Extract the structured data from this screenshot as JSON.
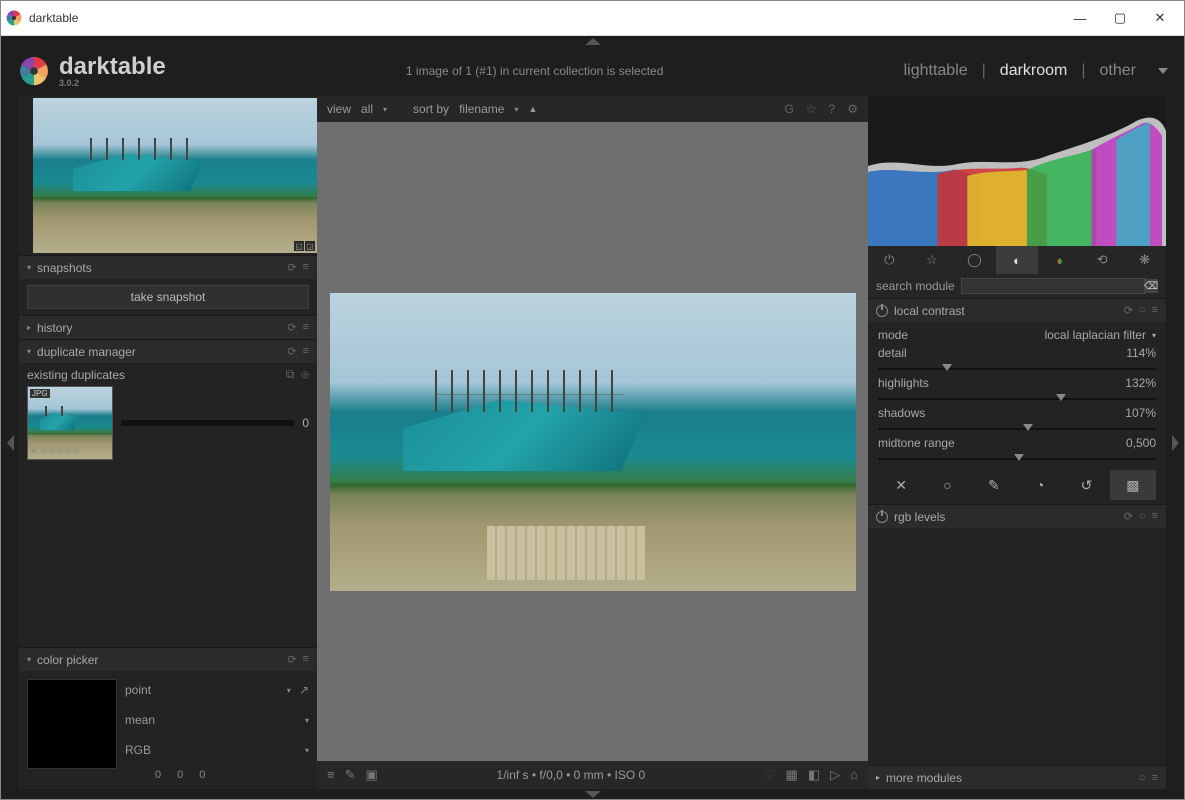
{
  "window": {
    "title": "darktable"
  },
  "brand": {
    "name": "darktable",
    "version": "3.0.2"
  },
  "header": {
    "message": "1 image of 1 (#1) in current collection is selected",
    "views": {
      "lighttable": "lighttable",
      "darkroom": "darkroom",
      "other": "other"
    }
  },
  "filterbar": {
    "view_label": "view",
    "view_value": "all",
    "sort_label": "sort by",
    "sort_value": "filename",
    "sort_dir": "▲",
    "icons": {
      "g": "G",
      "star": "☆",
      "help": "?",
      "gear": "⚙"
    }
  },
  "panels": {
    "snapshots": {
      "title": "snapshots",
      "button": "take snapshot"
    },
    "history": {
      "title": "history"
    },
    "duplicate_manager": {
      "title": "duplicate manager",
      "existing_label": "existing duplicates",
      "badge": "JPG",
      "rating": "✕ ☆☆☆☆☆",
      "count": "0"
    },
    "color_picker": {
      "title": "color picker",
      "mode": "point",
      "stat": "mean",
      "space": "RGB",
      "readout": [
        "0",
        "0",
        "0"
      ]
    }
  },
  "right": {
    "search_label": "search module",
    "local_contrast": {
      "title": "local contrast",
      "mode_label": "mode",
      "mode_value": "local laplacian filter",
      "params": [
        {
          "label": "detail",
          "value": "114%",
          "pos": 23
        },
        {
          "label": "highlights",
          "value": "132%",
          "pos": 64
        },
        {
          "label": "shadows",
          "value": "107%",
          "pos": 52
        },
        {
          "label": "midtone range",
          "value": "0,500",
          "pos": 49
        }
      ]
    },
    "rgb_levels": {
      "title": "rgb levels"
    },
    "more_modules": {
      "title": "more modules"
    }
  },
  "status": {
    "exposure": "1/inf s • f/0,0 • 0 mm • ISO 0"
  },
  "colors": {
    "accent": "#37a",
    "panel": "#232323",
    "text": "#a8a8a8"
  }
}
